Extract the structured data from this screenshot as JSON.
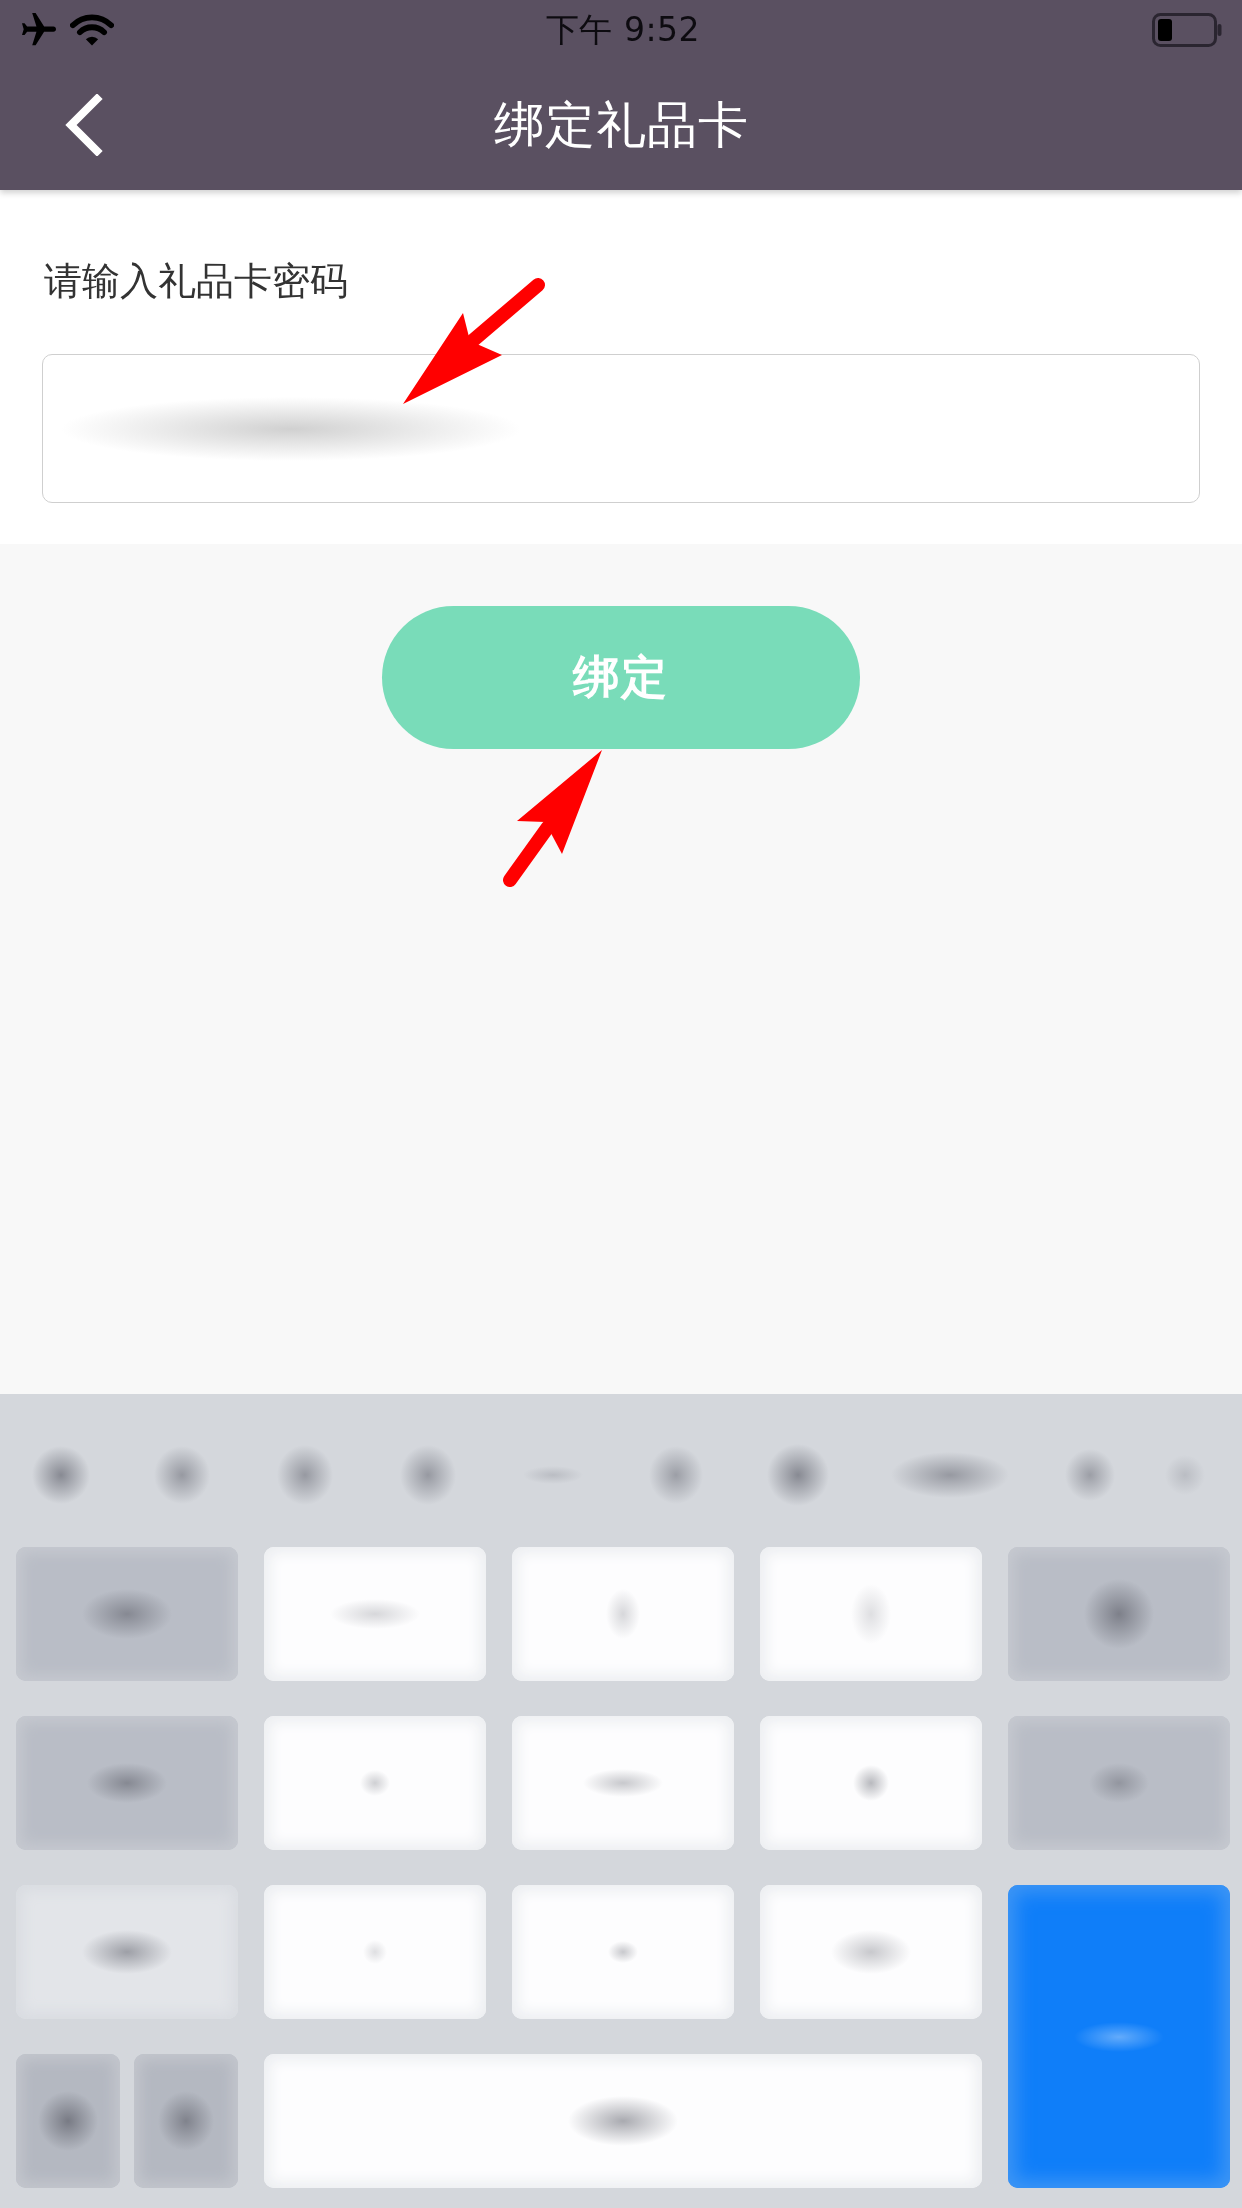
{
  "status_bar": {
    "time": "下午 9:52"
  },
  "nav_bar": {
    "title": "绑定礼品卡"
  },
  "form": {
    "label": "请输入礼品卡密码"
  },
  "bind_button": {
    "label": "绑定"
  }
}
